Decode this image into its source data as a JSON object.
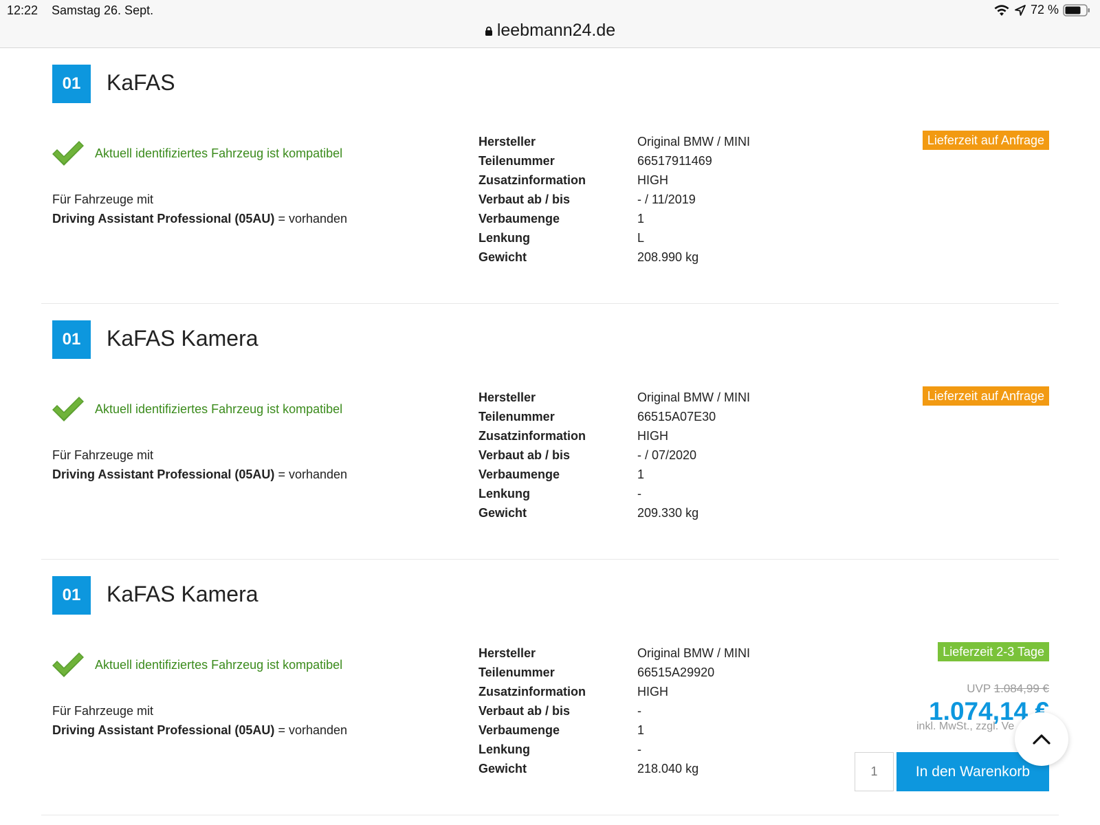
{
  "statusbar": {
    "time": "12:22",
    "date": "Samstag 26. Sept.",
    "battery": "72 %",
    "icons": [
      "wifi-icon",
      "location-icon",
      "battery-icon"
    ]
  },
  "urlbar": {
    "domain": "leebmann24.de",
    "icon": "lock-icon"
  },
  "colors": {
    "accent": "#0d97de",
    "compat": "#3b8b1c",
    "delivery_orange": "#f29a12",
    "delivery_green": "#7ac23a"
  },
  "products": [
    {
      "qty": "01",
      "title": "KaFAS",
      "compat_text": "Aktuell identifiziertes Fahrzeug ist kompatibel",
      "fuer_text": "Für Fahrzeuge mit",
      "feature_name": "Driving Assistant Professional (05AU)",
      "feature_status": "= vorhanden",
      "delivery": "Lieferzeit auf Anfrage",
      "specs": [
        {
          "label": "Hersteller",
          "value": "Original BMW / MINI"
        },
        {
          "label": "Teilenummer",
          "value": "66517911469"
        },
        {
          "label": "Zusatzinformation",
          "value": "HIGH"
        },
        {
          "label": "Verbaut ab / bis",
          "value": "- / 11/2019"
        },
        {
          "label": "Verbaumenge",
          "value": "1"
        },
        {
          "label": "Lenkung",
          "value": "L"
        },
        {
          "label": "Gewicht",
          "value": "208.990 kg"
        }
      ]
    },
    {
      "qty": "01",
      "title": "KaFAS Kamera",
      "compat_text": "Aktuell identifiziertes Fahrzeug ist kompatibel",
      "fuer_text": "Für Fahrzeuge mit",
      "feature_name": "Driving Assistant Professional (05AU)",
      "feature_status": "= vorhanden",
      "delivery": "Lieferzeit auf Anfrage",
      "specs": [
        {
          "label": "Hersteller",
          "value": "Original BMW / MINI"
        },
        {
          "label": "Teilenummer",
          "value": "66515A07E30"
        },
        {
          "label": "Zusatzinformation",
          "value": "HIGH"
        },
        {
          "label": "Verbaut ab / bis",
          "value": "- / 07/2020"
        },
        {
          "label": "Verbaumenge",
          "value": "1"
        },
        {
          "label": "Lenkung",
          "value": "-"
        },
        {
          "label": "Gewicht",
          "value": "209.330 kg"
        }
      ]
    },
    {
      "qty": "01",
      "title": "KaFAS Kamera",
      "compat_text": "Aktuell identifiziertes Fahrzeug ist kompatibel",
      "fuer_text": "Für Fahrzeuge mit",
      "feature_name": "Driving Assistant Professional (05AU)",
      "feature_status": "= vorhanden",
      "delivery": "Lieferzeit 2-3 Tage",
      "uvp_label": "UVP",
      "uvp_price": "1.084,99 €",
      "price": "1.074,14 €",
      "tax_note": "inkl. MwSt., zzgl. Ve",
      "qty_input": "1",
      "cart_label": "In den Warenkorb",
      "specs": [
        {
          "label": "Hersteller",
          "value": "Original BMW / MINI"
        },
        {
          "label": "Teilenummer",
          "value": "66515A29920"
        },
        {
          "label": "Zusatzinformation",
          "value": "HIGH"
        },
        {
          "label": "Verbaut ab / bis",
          "value": "-"
        },
        {
          "label": "Verbaumenge",
          "value": "1"
        },
        {
          "label": "Lenkung",
          "value": "-"
        },
        {
          "label": "Gewicht",
          "value": "218.040 kg"
        }
      ]
    }
  ],
  "scroll_top": {
    "icon": "chevron-up-icon"
  }
}
